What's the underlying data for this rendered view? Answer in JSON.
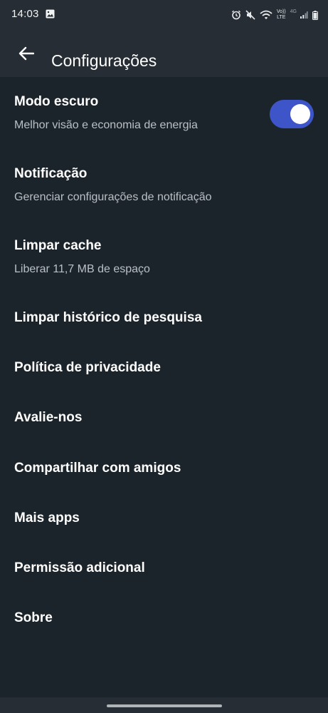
{
  "status_bar": {
    "time": "14:03",
    "lte_top": "Vo))",
    "lte_bottom": "LTE",
    "network_label": "4G",
    "icons": [
      "gallery-icon",
      "alarm-icon",
      "mute-icon",
      "wifi-icon",
      "volte-icon",
      "signal-icon",
      "battery-icon"
    ]
  },
  "header": {
    "back_icon": "arrow-left-icon",
    "title": "Configurações"
  },
  "settings": {
    "dark_mode": {
      "title": "Modo escuro",
      "subtitle": "Melhor visão e economia de energia",
      "toggle_on": true,
      "toggle_color": "#3d55c9"
    },
    "notification": {
      "title": "Notificação",
      "subtitle": "Gerenciar configurações de notificação"
    },
    "clear_cache": {
      "title": "Limpar cache",
      "subtitle": "Liberar 11,7 MB de espaço"
    },
    "clear_search_history": {
      "title": "Limpar histórico de pesquisa"
    },
    "privacy_policy": {
      "title": "Política de privacidade"
    },
    "rate_us": {
      "title": "Avalie-nos"
    },
    "share_friends": {
      "title": "Compartilhar com amigos"
    },
    "more_apps": {
      "title": "Mais apps"
    },
    "additional_permission": {
      "title": "Permissão adicional"
    },
    "about": {
      "title": "Sobre"
    }
  },
  "colors": {
    "background": "#1c242b",
    "app_bar": "#262d34",
    "subtitle": "#b9c0c5"
  }
}
